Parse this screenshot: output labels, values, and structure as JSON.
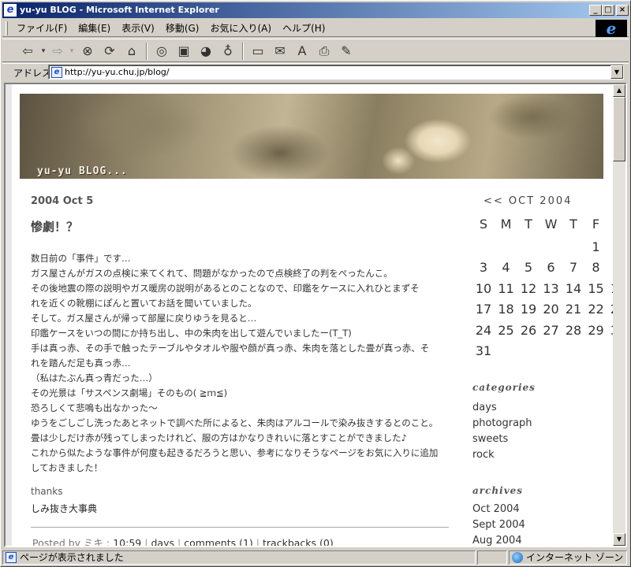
{
  "window": {
    "title": "yu-yu BLOG - Microsoft Internet Explorer",
    "min": "_",
    "max": "□",
    "close": "×"
  },
  "menu": [
    "ファイル(F)",
    "編集(E)",
    "表示(V)",
    "移動(G)",
    "お気に入り(A)",
    "ヘルプ(H)"
  ],
  "brand_logo": "e",
  "toolbar_icons": [
    "back-icon",
    "forward-icon",
    "stop-icon",
    "refresh-icon",
    "home-icon",
    "search-icon",
    "favorites-icon",
    "history-icon",
    "channels-icon",
    "fullscreen-icon",
    "mail-icon",
    "font-icon",
    "print-icon",
    "edit-icon"
  ],
  "address": {
    "label": "アドレス",
    "url": "http://yu-yu.chu.jp/blog/"
  },
  "banner": {
    "logo_text": "yu-yu BLOG..."
  },
  "entry": {
    "date": "2004 Oct 5",
    "title": "惨劇！？",
    "lines": [
      "数日前の「事件」です…",
      "ガス屋さんがガスの点検に来てくれて、問題がなかったので点検終了の判をぺったんこ。",
      "その後地震の際の説明やガス暖房の説明があるとのことなので、印鑑をケースに入れひとまずそ",
      "れを近くの靴棚にぽんと置いてお話を聞いていました。",
      "そして。ガス屋さんが帰って部屋に戻りゆうを見ると…",
      "印鑑ケースをいつの間にか持ち出し、中の朱肉を出して遊んでいましたー(T_T)",
      "手は真っ赤、その手で触ったテーブルやタオルや服や顔が真っ赤、朱肉を落とした畳が真っ赤、そ",
      "れを踏んだ足も真っ赤…",
      "（私はたぶん真っ青だった…）",
      "その光景は「サスペンス劇場」そのもの( ≧ｍ≦)",
      "恐ろしくて悲鳴も出なかった～",
      "ゆうをごしごし洗ったあとネットで調べた所によると、朱肉はアルコールで染み抜きするとのこと。",
      "畳は少しだけ赤が残ってしまったけれど、服の方はかなりきれいに落とすことができました♪",
      "これから似たような事件が何度も起きるだろうと思い、参考になりそうなページをお気に入りに追加",
      "しておきました！"
    ],
    "thanks": "thanks",
    "link": "しみ抜き大事典",
    "footer": {
      "posted_by": "Posted by ミキ : ",
      "time": "10:59",
      "category": "days",
      "comments": "comments (1)",
      "trackbacks": "trackbacks (0)",
      "sep": "|"
    }
  },
  "calendar": {
    "header": "<< OCT 2004",
    "weekdays": [
      "S",
      "M",
      "T",
      "W",
      "T",
      "F",
      "S"
    ],
    "weeks": [
      [
        "",
        "",
        "",
        "",
        "",
        "1",
        "2"
      ],
      [
        "3",
        "4",
        "5",
        "6",
        "7",
        "8",
        "9"
      ],
      [
        "10",
        "11",
        "12",
        "13",
        "14",
        "15",
        "16"
      ],
      [
        "17",
        "18",
        "19",
        "20",
        "21",
        "22",
        "23"
      ],
      [
        "24",
        "25",
        "26",
        "27",
        "28",
        "29",
        "30"
      ],
      [
        "31",
        "",
        "",
        "",
        "",
        "",
        ""
      ]
    ]
  },
  "categories": {
    "title": "categories",
    "items": [
      "days",
      "photograph",
      "sweets",
      "rock"
    ]
  },
  "archives": {
    "title": "archives",
    "items": [
      "Oct 2004",
      "Sept 2004",
      "Aug 2004"
    ]
  },
  "status": {
    "message": "ページが表示されました",
    "zone": "インターネット ゾーン"
  }
}
